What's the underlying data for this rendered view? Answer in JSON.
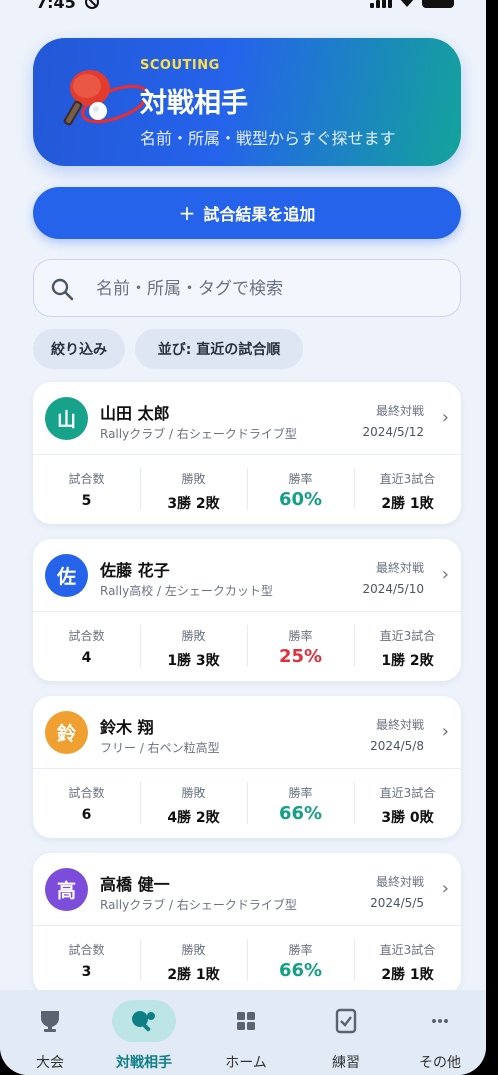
{
  "status": {
    "time": "7:45"
  },
  "hero": {
    "kicker": "SCOUTING",
    "title": "対戦相手",
    "subtitle": "名前・所属・戦型からすぐ探せます"
  },
  "add_button": {
    "label": "試合結果を追加"
  },
  "search": {
    "placeholder": "名前・所属・タグで検索"
  },
  "chips": {
    "filter": "絞り込み",
    "sort": "並び: 直近の試合順"
  },
  "stat_labels": {
    "matches": "試合数",
    "record": "勝敗",
    "rate": "勝率",
    "recent": "直近3試合"
  },
  "opponents": [
    {
      "initial": "山",
      "name": "山田 太郎",
      "team": "Rallyクラブ / 右シェークドライブ型",
      "last_label": "最終対戦",
      "last_date": "2024/5/12",
      "matches": "5",
      "record": "3勝 2敗",
      "rate": "60%",
      "recent": "2勝 1敗",
      "avatar_color": "#17a38b",
      "rate_color": "#14a085"
    },
    {
      "initial": "佐",
      "name": "佐藤 花子",
      "team": "Rally高校 / 左シェークカット型",
      "last_label": "最終対戦",
      "last_date": "2024/5/10",
      "matches": "4",
      "record": "1勝 3敗",
      "rate": "25%",
      "recent": "1勝 2敗",
      "avatar_color": "#2563eb",
      "rate_color": "#e0323c"
    },
    {
      "initial": "鈴",
      "name": "鈴木 翔",
      "team": "フリー / 右ペン粒高型",
      "last_label": "最終対戦",
      "last_date": "2024/5/8",
      "matches": "6",
      "record": "4勝 2敗",
      "rate": "66%",
      "recent": "3勝 0敗",
      "avatar_color": "#f0a030",
      "rate_color": "#14a085"
    },
    {
      "initial": "高",
      "name": "高橋 健一",
      "team": "Rallyクラブ / 右シェークドライブ型",
      "last_label": "最終対戦",
      "last_date": "2024/5/5",
      "matches": "3",
      "record": "2勝 1敗",
      "rate": "66%",
      "recent": "2勝 1敗",
      "avatar_color": "#7c4ddb",
      "rate_color": "#14a085"
    }
  ],
  "tabs": [
    {
      "label": "大会",
      "icon": "trophy-icon"
    },
    {
      "label": "対戦相手",
      "icon": "paddle-icon"
    },
    {
      "label": "ホーム",
      "icon": "grid-icon"
    },
    {
      "label": "練習",
      "icon": "clipboard-icon"
    },
    {
      "label": "その他",
      "icon": "more-icon"
    }
  ]
}
